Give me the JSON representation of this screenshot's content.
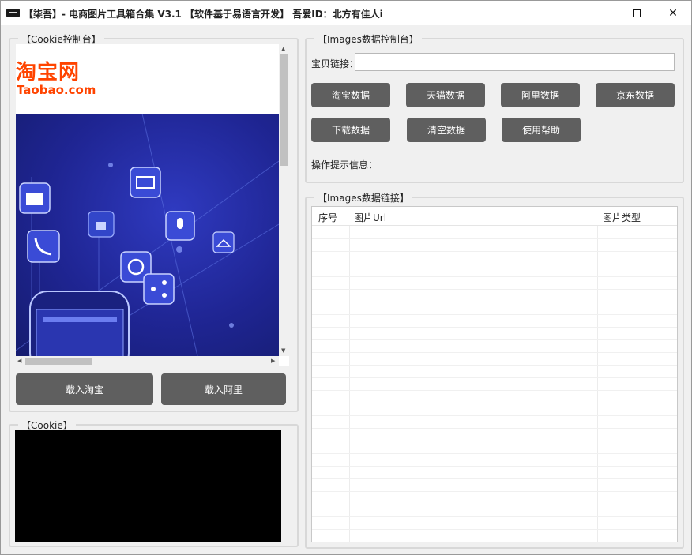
{
  "window": {
    "title": "【柒吾】- 电商图片工具箱合集 V3.1    【软件基于易语言开发】   吾爱ID：北方有佳人i",
    "minimize_glyph": "",
    "maximize_glyph": "",
    "close_glyph": "✕"
  },
  "cookie_console": {
    "title": "【Cookie控制台】",
    "logo_cn": "淘宝网",
    "logo_en": "Taobao.com",
    "load_taobao_label": "载入淘宝",
    "load_ali_label": "载入阿里"
  },
  "cookie_panel": {
    "title": "【Cookie】"
  },
  "images_console": {
    "title": "【Images数据控制台】",
    "link_label": "宝贝链接：",
    "link_value": "",
    "buttons": [
      "淘宝数据",
      "天猫数据",
      "阿里数据",
      "京东数据",
      "下载数据",
      "清空数据",
      "使用帮助"
    ],
    "tip_label": "操作提示信息："
  },
  "images_links": {
    "title": "【Images数据链接】",
    "columns": [
      "序号",
      "图片Url",
      "图片类型"
    ],
    "rows": []
  },
  "colors": {
    "button_bg": "#5f5f5f",
    "banner_blue": "#1f2593",
    "logo_orange": "#ff4400"
  }
}
